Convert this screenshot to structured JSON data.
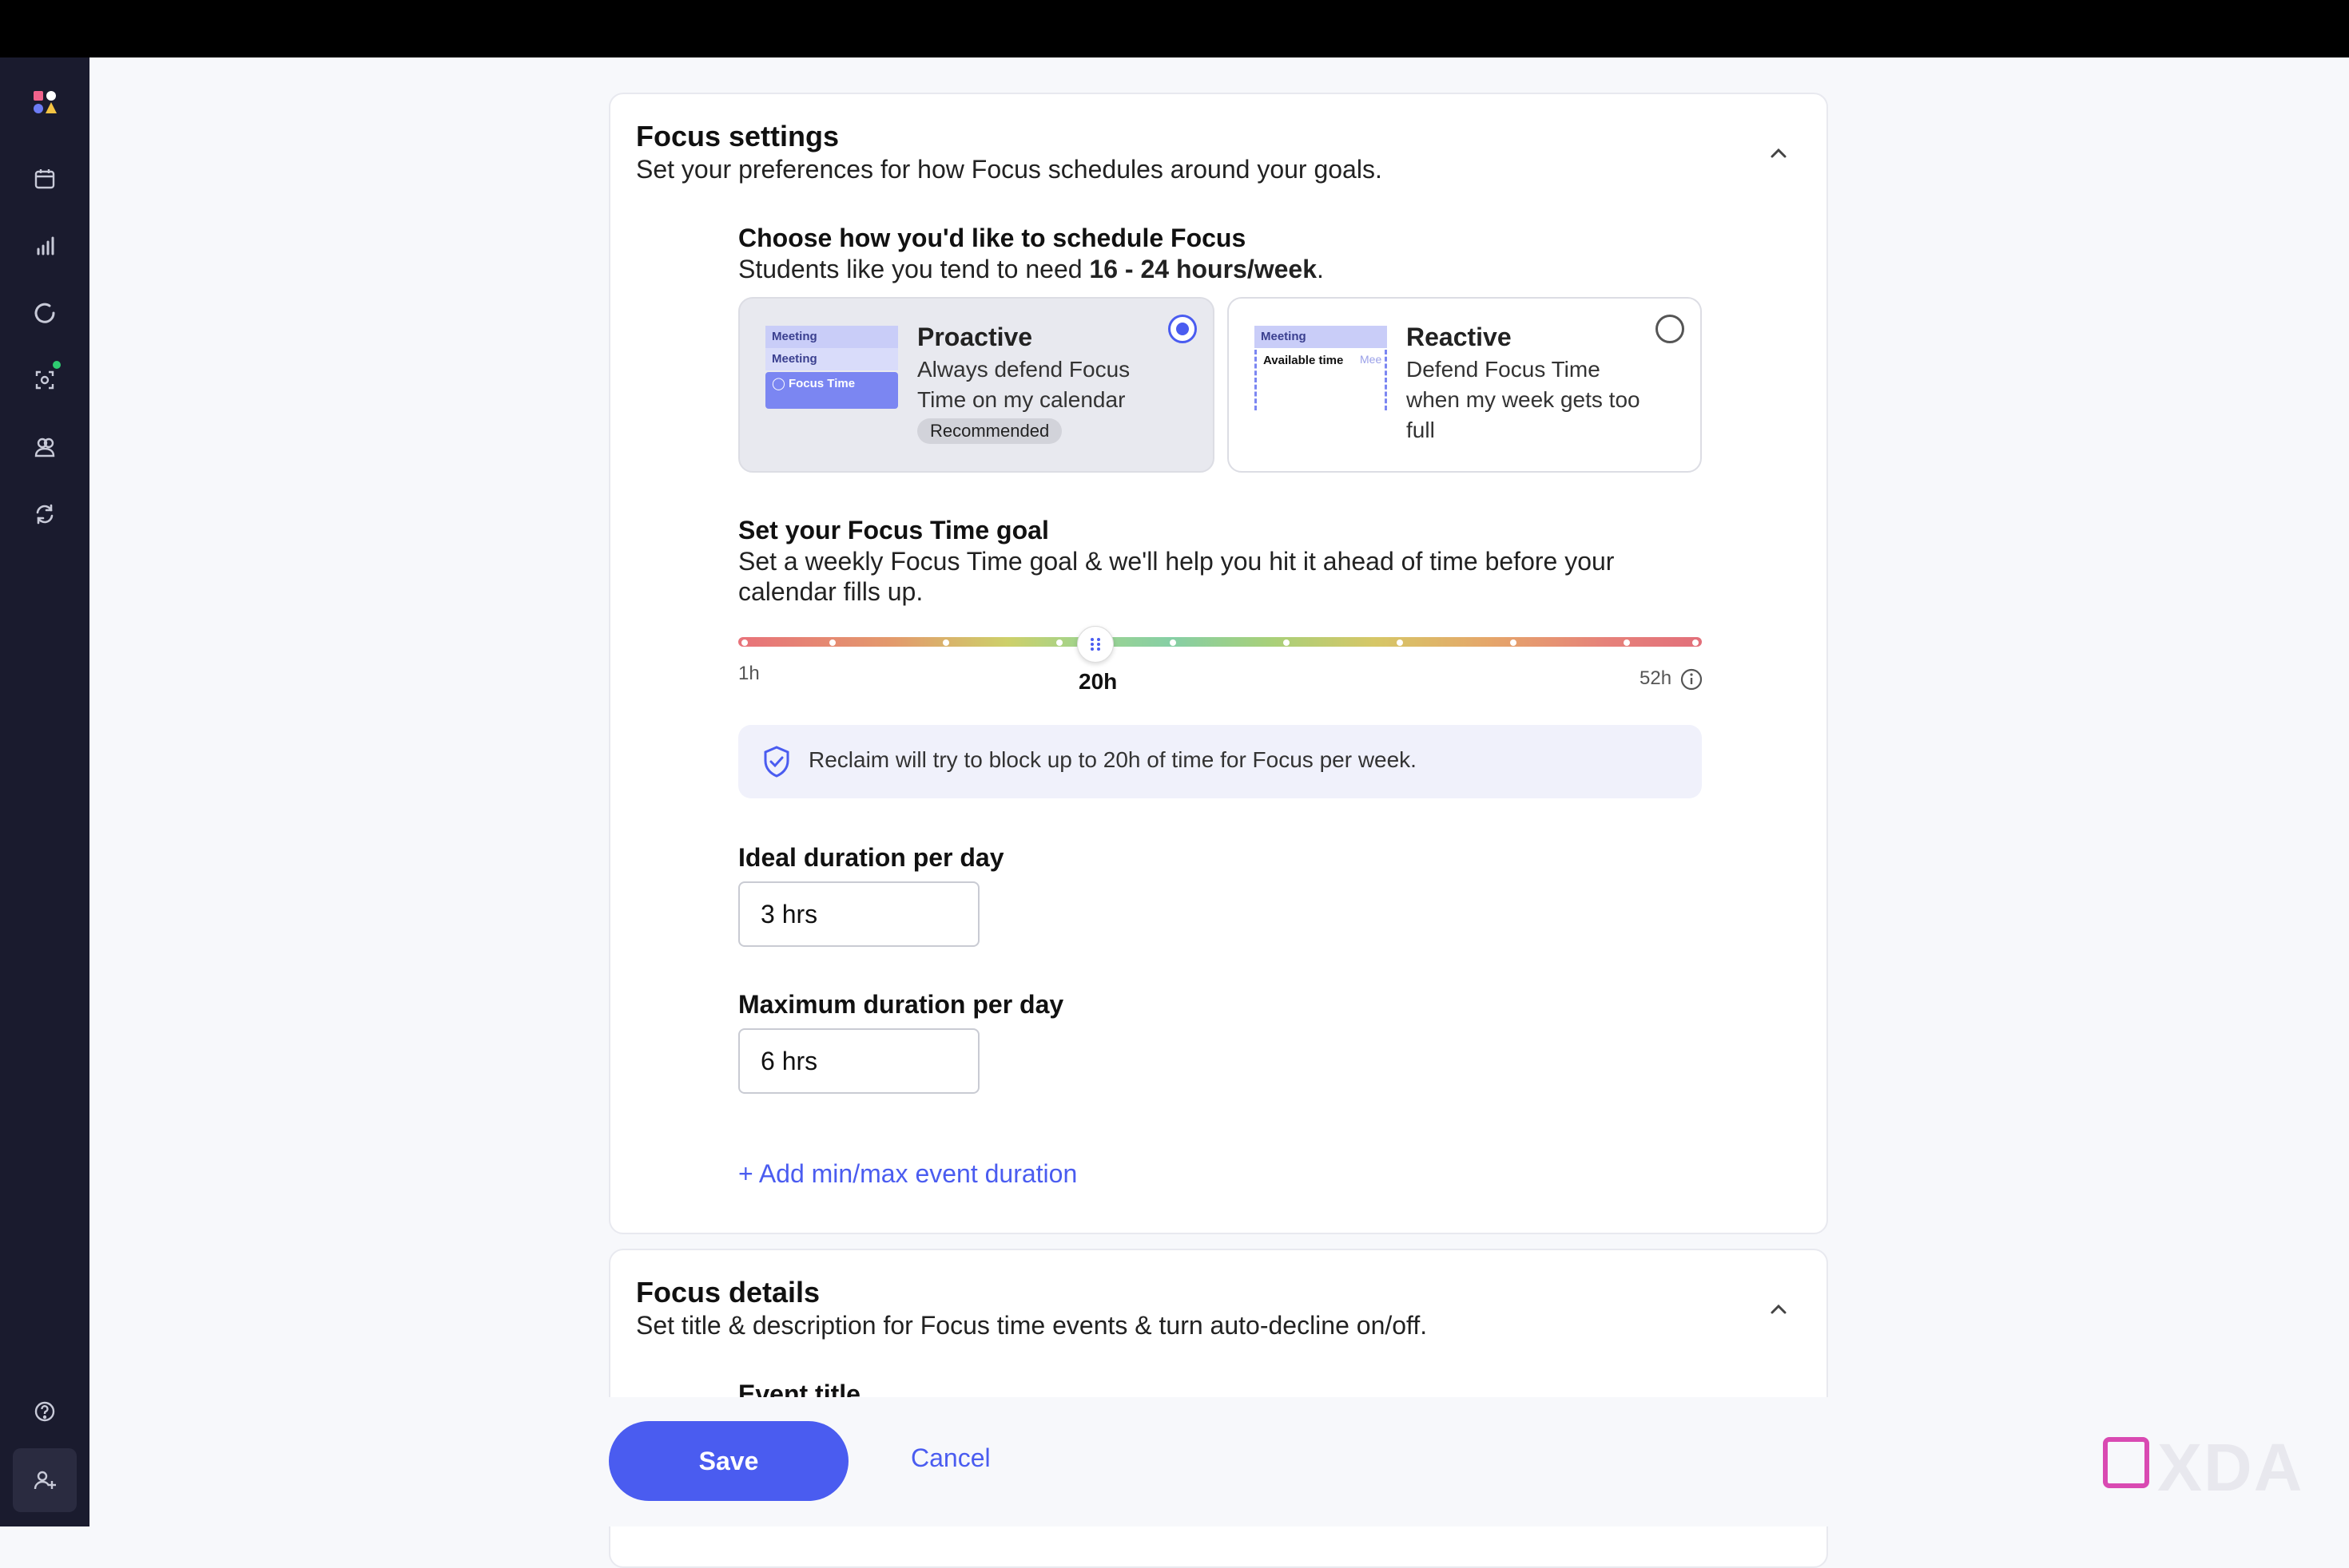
{
  "focus_settings": {
    "title": "Focus settings",
    "subtitle": "Set your preferences for how Focus schedules around your goals.",
    "schedule": {
      "title": "Choose how you'd like to schedule Focus",
      "text_prefix": "Students like you tend to need ",
      "text_hours": "16 - 24 hours/week",
      "text_suffix": ".",
      "proactive": {
        "title": "Proactive",
        "desc": "Always defend Focus Time on my calendar",
        "badge": "Recommended",
        "mini_rows": [
          "Meeting",
          "Meeting",
          "Focus Time"
        ],
        "selected": true
      },
      "reactive": {
        "title": "Reactive",
        "desc": "Defend Focus Time when my week gets too full",
        "mini_rows": [
          "Meeting",
          "Available time",
          "Mee"
        ],
        "selected": false
      }
    },
    "goal": {
      "title": "Set your Focus Time goal",
      "text": "Set a weekly Focus Time goal & we'll help you hit it ahead of time before your calendar fills up.",
      "slider_min": "1h",
      "slider_value": "20h",
      "slider_max": "52h",
      "slider_fraction": 0.37,
      "info_text": "Reclaim will try to block up to 20h of time for Focus per week."
    },
    "ideal": {
      "label": "Ideal duration per day",
      "value": "3 hrs"
    },
    "maximum": {
      "label": "Maximum duration per day",
      "value": "6 hrs"
    },
    "add_link": "+ Add min/max event duration"
  },
  "focus_details": {
    "title": "Focus details",
    "subtitle": "Set title & description for Focus time events & turn auto-decline on/off.",
    "event_title_label": "Event title"
  },
  "actions": {
    "save": "Save",
    "cancel": "Cancel"
  },
  "watermark": "XDA",
  "colors": {
    "accent": "#4a5cf0",
    "sidebar": "#1a1b2e"
  }
}
